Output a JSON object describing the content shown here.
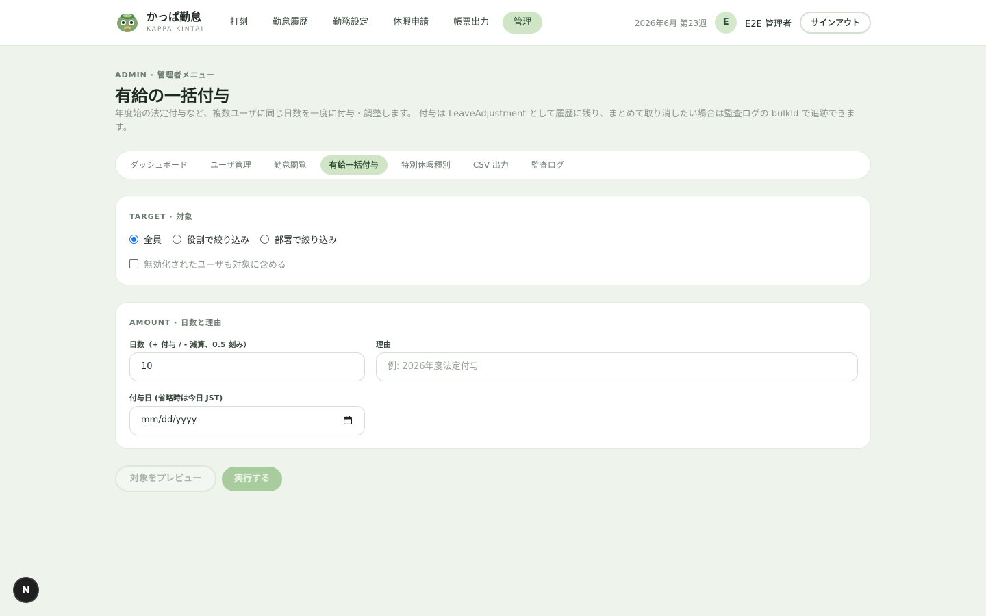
{
  "app": {
    "name": "かっぱ勤怠",
    "subtitle": "KAPPA KINTAI",
    "logo_icon": "kappa-logo-icon"
  },
  "nav": {
    "items": [
      {
        "label": "打刻"
      },
      {
        "label": "勤怠履歴"
      },
      {
        "label": "勤務設定"
      },
      {
        "label": "休暇申請"
      },
      {
        "label": "帳票出力"
      },
      {
        "label": "管理",
        "active": true
      }
    ]
  },
  "header": {
    "week_label": "2026年6月 第23週",
    "avatar_initial": "E",
    "user_name": "E2E 管理者",
    "signout_label": "サインアウト"
  },
  "page": {
    "eyebrow": "ADMIN · 管理者メニュー",
    "title": "有給の一括付与",
    "description": "年度始の法定付与など、複数ユーザに同じ日数を一度に付与・調整します。 付与は LeaveAdjustment として履歴に残り、まとめて取り消したい場合は監査ログの bulkId で追跡できます。"
  },
  "subtabs": [
    {
      "label": "ダッシュボード"
    },
    {
      "label": "ユーザ管理"
    },
    {
      "label": "勤怠閲覧"
    },
    {
      "label": "有給一括付与",
      "active": true
    },
    {
      "label": "特別休暇種別"
    },
    {
      "label": "CSV 出力"
    },
    {
      "label": "監査ログ"
    }
  ],
  "target": {
    "section_label": "TARGET · 対象",
    "options": [
      {
        "label": "全員",
        "checked": true
      },
      {
        "label": "役割で絞り込み",
        "checked": false
      },
      {
        "label": "部署で絞り込み",
        "checked": false
      }
    ],
    "include_disabled_label": "無効化されたユーザも対象に含める",
    "include_disabled_checked": false
  },
  "amount": {
    "section_label": "AMOUNT · 日数と理由",
    "days_label": "日数（+ 付与 / - 減算、0.5 刻み）",
    "days_value": "10",
    "reason_label": "理由",
    "reason_placeholder": "例: 2026年度法定付与",
    "date_label": "付与日 (省略時は今日 JST)",
    "date_placeholder": "mm/dd/yyyy"
  },
  "actions": {
    "preview_label": "対象をプレビュー",
    "run_label": "実行する"
  },
  "dev_badge": "N",
  "colors": {
    "accent": "#cfe5c6",
    "background": "#eef4ec",
    "run_button": "#a8cc9e",
    "radio_checked": "#1a73e8"
  }
}
